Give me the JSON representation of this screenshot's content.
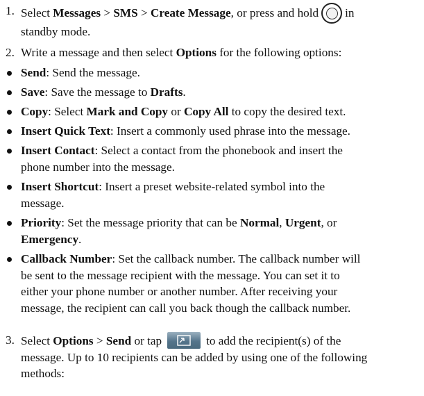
{
  "steps": {
    "s1": {
      "num": "1.",
      "pre": "Select ",
      "messages": "Messages",
      "gt1": " > ",
      "sms": "SMS",
      "gt2": " > ",
      "create": "Create Message",
      "mid": ", or press and hold",
      "tail1": "in",
      "tail2": "standby mode."
    },
    "s2": {
      "num": "2.",
      "pre": "Write a message and then select ",
      "options": "Options",
      "post": " for the following options:"
    },
    "s3": {
      "num": "3.",
      "pre": "Select ",
      "options": "Options",
      "gt": " > ",
      "send": "Send",
      "or": " or tap",
      "post": "to add the recipient(s) of the",
      "line2": "message. Up to 10 recipients can be added by using one of the following",
      "line3": "methods:"
    }
  },
  "bullets": {
    "send": {
      "term": "Send",
      "text": ": Send the message."
    },
    "save": {
      "term": "Save",
      "text": ": Save the message to ",
      "drafts": "Drafts",
      "end": "."
    },
    "copy": {
      "term": "Copy",
      "t1": ": Select ",
      "b1": "Mark and Copy",
      "t2": " or ",
      "b2": "Copy All",
      "t3": " to copy the desired text."
    },
    "quick": {
      "term": "Insert Quick Text",
      "text": ": Insert a commonly used phrase into the message."
    },
    "contact": {
      "term": "Insert Contact",
      "text": ": Select a contact from the phonebook and insert the",
      "line2": "phone number into the message."
    },
    "shortcut": {
      "term": "Insert Shortcut",
      "text": ": Insert a preset website-related symbol into the",
      "line2": "message."
    },
    "priority": {
      "term": "Priority",
      "t1": ": Set the message priority that can be ",
      "normal": "Normal",
      "comma": ", ",
      "urgent": "Urgent",
      "or": ", or",
      "emergency": "Emergency",
      "end": "."
    },
    "callback": {
      "term": "Callback Number",
      "text": ": Set the callback number. The callback number will",
      "line2": "be sent to the message recipient with the message. You can set it to",
      "line3": "either your phone number or another number. After receiving your",
      "line4": "message, the recipient can call you back though the callback number."
    }
  },
  "icons": {
    "nav_key": "navigation-key-icon",
    "send_button": "send-message-icon"
  },
  "colors": {
    "text": "#111111",
    "icon_blue": "#55758b"
  }
}
